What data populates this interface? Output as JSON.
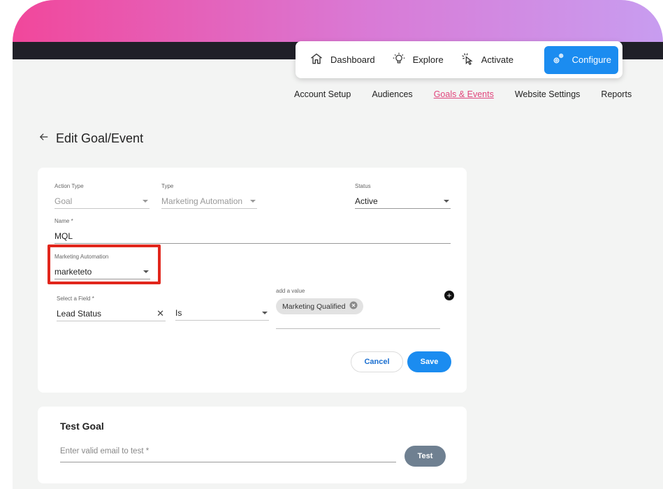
{
  "top_nav": {
    "items": [
      {
        "label": "Dashboard",
        "icon": "home-icon"
      },
      {
        "label": "Explore",
        "icon": "lightbulb-icon"
      },
      {
        "label": "Activate",
        "icon": "click-icon"
      },
      {
        "label": "Configure",
        "icon": "gears-icon",
        "active": true
      }
    ]
  },
  "sub_nav": {
    "items": [
      "Account Setup",
      "Audiences",
      "Goals & Events",
      "Website Settings",
      "Reports"
    ],
    "selected": "Goals & Events"
  },
  "page": {
    "title": "Edit Goal/Event"
  },
  "form": {
    "action_type": {
      "label": "Action Type",
      "value": "Goal"
    },
    "type": {
      "label": "Type",
      "value": "Marketing Automation"
    },
    "status": {
      "label": "Status",
      "value": "Active"
    },
    "name": {
      "label": "Name *",
      "value": "MQL"
    },
    "marketing_automation": {
      "label": "Marketing Automation",
      "value": "marketeto"
    },
    "select_field": {
      "label": "Select a Field *",
      "value": "Lead Status"
    },
    "operator": {
      "value": "Is"
    },
    "add_value": {
      "label": "add a value",
      "chip": "Marketing Qualified"
    },
    "cancel_label": "Cancel",
    "save_label": "Save"
  },
  "test_goal": {
    "title": "Test Goal",
    "placeholder": "Enter valid email to test *",
    "test_label": "Test"
  },
  "colors": {
    "accent": "#1b8cf0",
    "selected_tab": "#e0457c",
    "highlight": "#e1261c",
    "test_button": "#6f8091"
  }
}
